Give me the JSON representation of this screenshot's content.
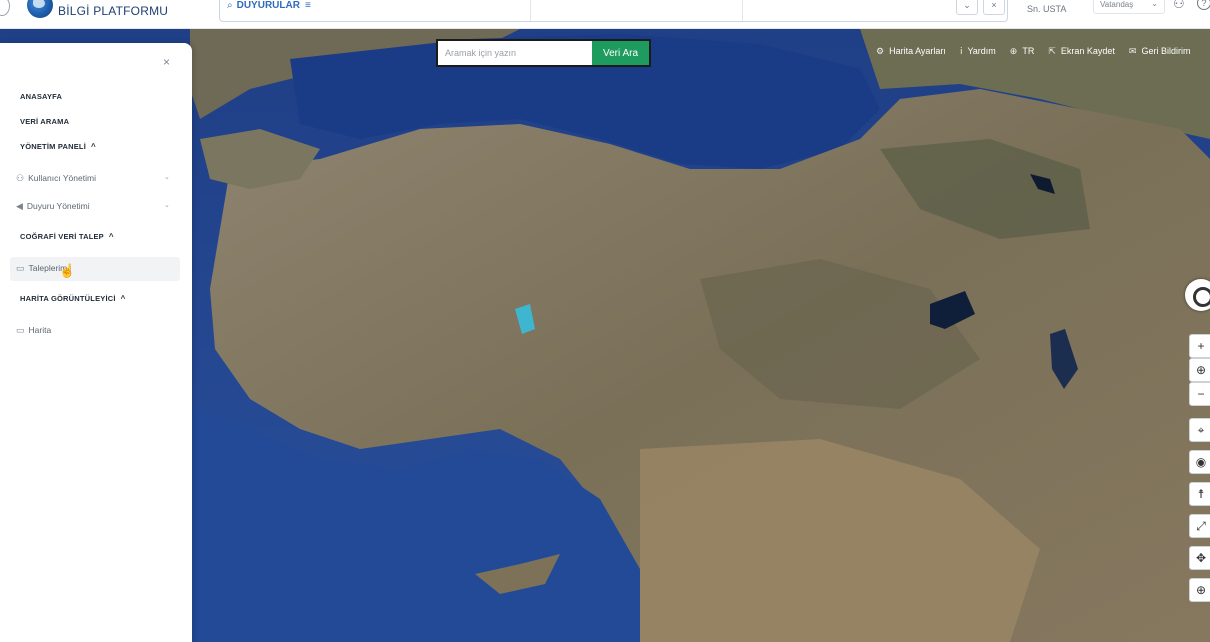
{
  "header": {
    "brand": "BİLGİ PLATFORMU",
    "search_tag": "DUYURULAR",
    "search_tag_icon": "search-icon",
    "user": "Sn. USTA",
    "role": "Vatandaş",
    "btn_down": "⌄",
    "btn_close": "×"
  },
  "map": {
    "search_placeholder": "Aramak için yazın",
    "search_button": "Veri Ara",
    "toolbar": [
      {
        "label": "Harita Ayarları",
        "icon": "settings-icon"
      },
      {
        "label": "Yardım",
        "icon": "info-icon"
      },
      {
        "label": "TR",
        "icon": "globe-icon"
      },
      {
        "label": "Ekran Kaydet",
        "icon": "export-icon"
      },
      {
        "label": "Geri Bildirim",
        "icon": "feedback-icon"
      }
    ],
    "controls": [
      "zoom-in",
      "globe",
      "zoom-out",
      "location",
      "eye",
      "person",
      "expand",
      "move",
      "add"
    ]
  },
  "sidebar": {
    "close": "×",
    "items": [
      {
        "label": "ANASAYFA"
      },
      {
        "label": "VERİ ARAMA"
      },
      {
        "label": "YÖNETİM PANELİ"
      },
      {
        "label": "Kullanıcı Yönetimi"
      },
      {
        "label": "Duyuru Yönetimi"
      },
      {
        "label": "COĞRAFİ VERİ TALEP"
      },
      {
        "label": "Taleplerim"
      },
      {
        "label": "HARİTA GÖRÜNTÜLEYİCİ"
      },
      {
        "label": "Harita"
      }
    ]
  }
}
